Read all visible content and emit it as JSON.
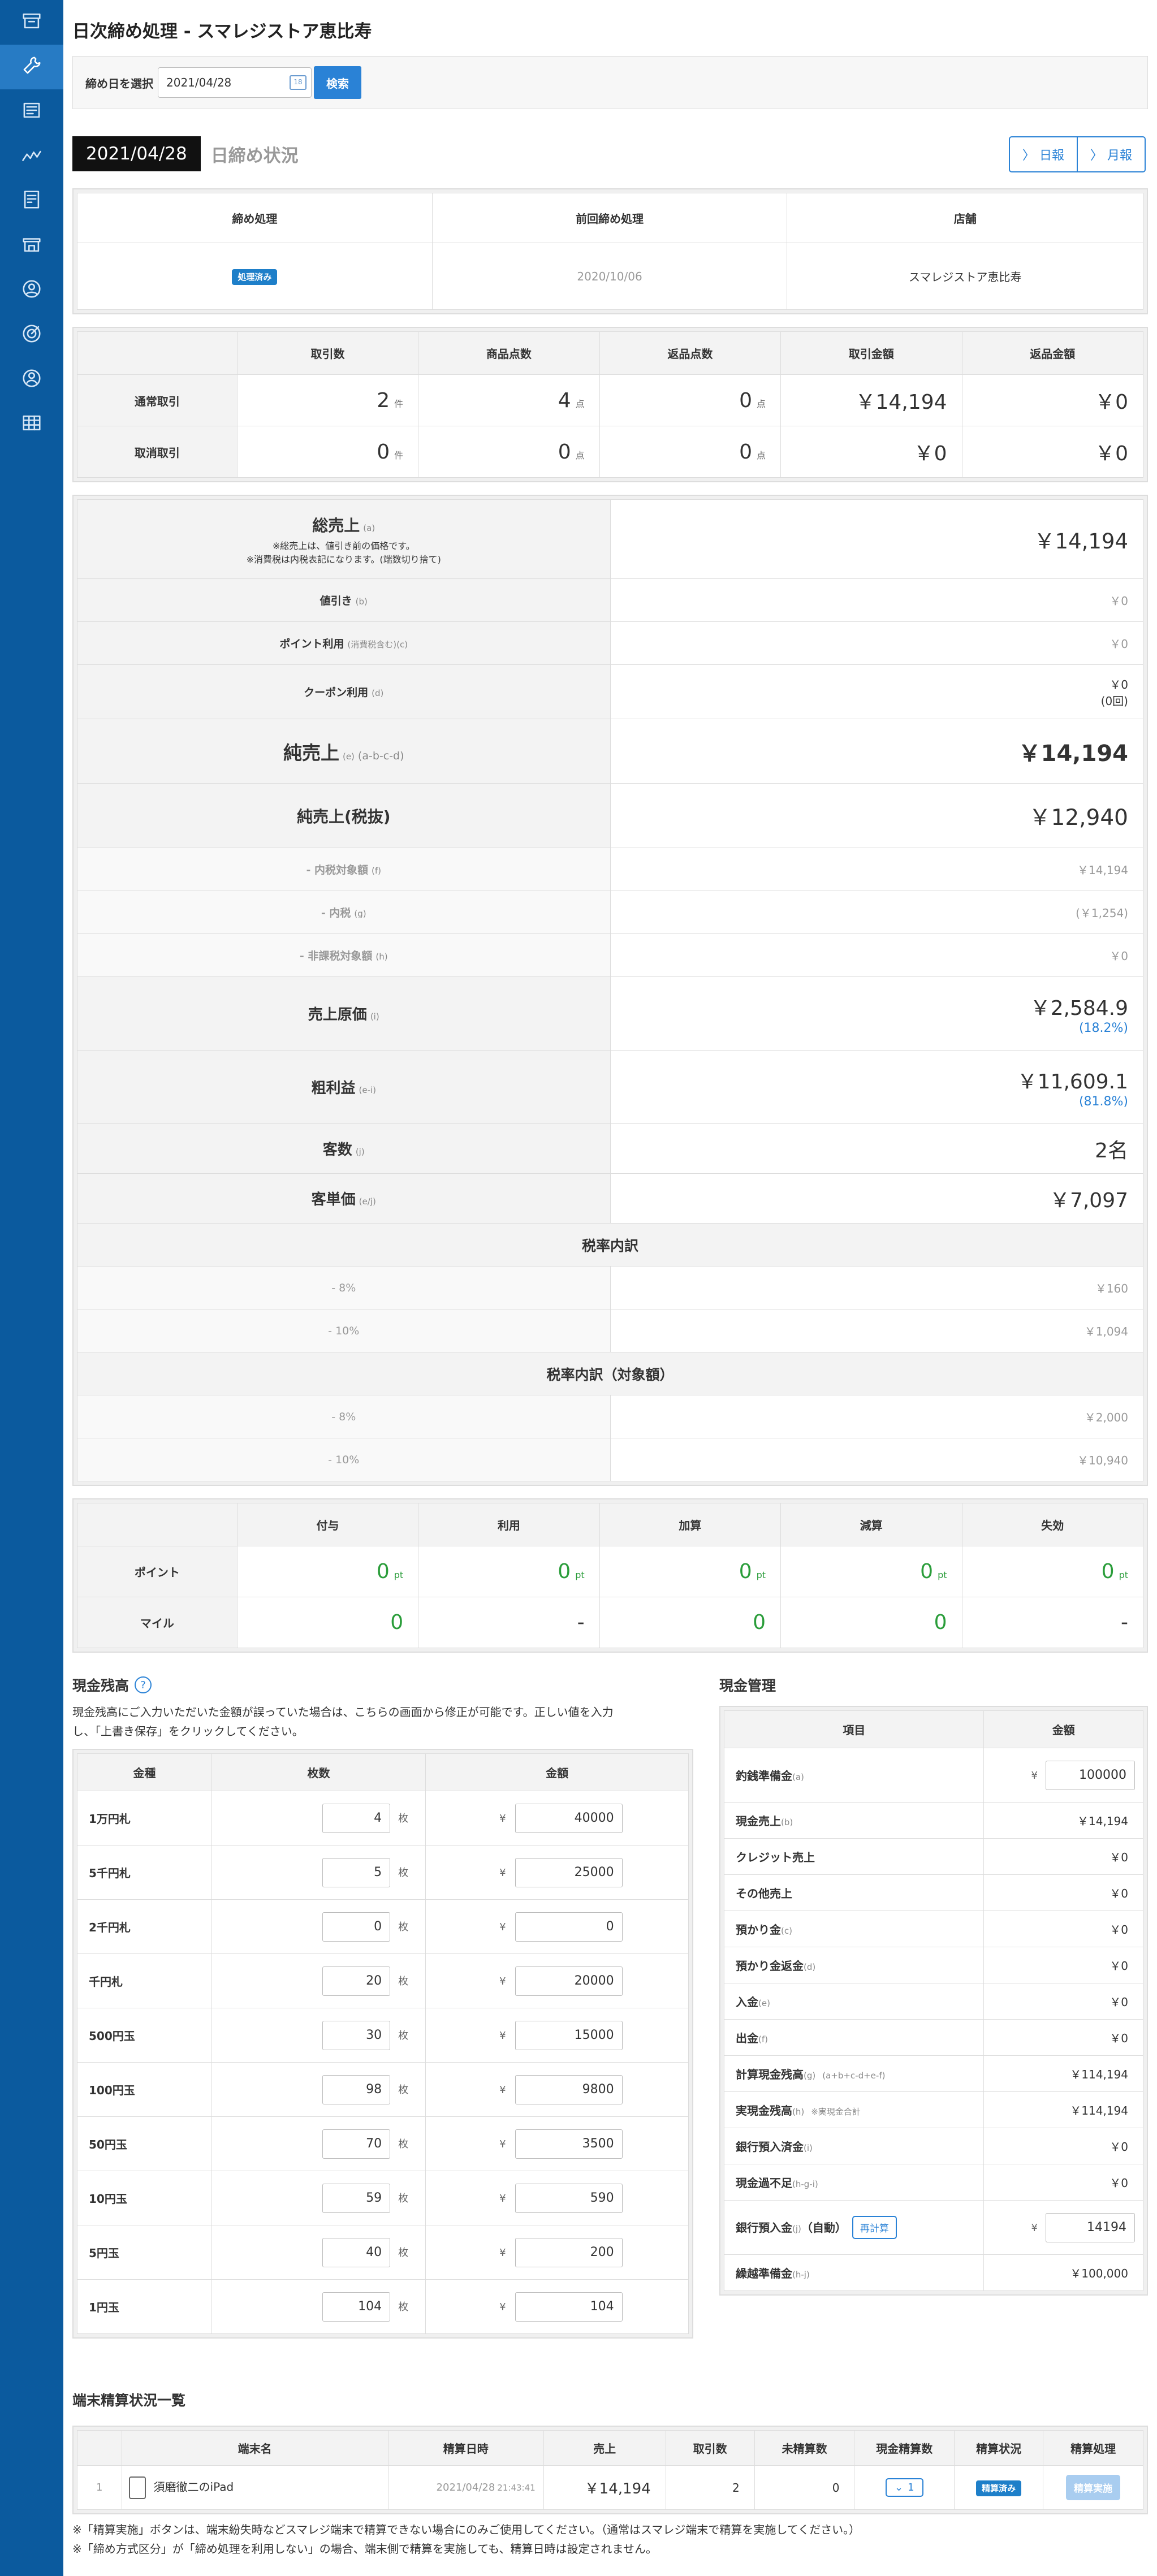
{
  "page": {
    "title": "日次締め処理 - スマレジストア恵比寿"
  },
  "sidebar": {
    "icons": [
      "archive-icon",
      "wrench-icon",
      "document-icon",
      "chart-line-icon",
      "report-icon",
      "store-icon",
      "user-circle-icon",
      "target-icon",
      "person-icon",
      "grid-table-icon"
    ],
    "active": 1
  },
  "search": {
    "label": "締め日を選択",
    "date": "2021/04/28",
    "button": "検索"
  },
  "status": {
    "date": "2021/04/28",
    "label": "日締め状況",
    "daily": "日報",
    "monthly": "月報"
  },
  "summary": {
    "headers": [
      "締め処理",
      "前回締め処理",
      "店舗"
    ],
    "badge": "処理済み",
    "prev_date": "2020/10/06",
    "store": "スマレジストア恵比寿"
  },
  "transactions": {
    "headers": [
      "取引数",
      "商品点数",
      "返品点数",
      "取引金額",
      "返品金額"
    ],
    "rows": [
      {
        "label": "通常取引",
        "count": "2",
        "count_unit": "件",
        "items": "4",
        "items_unit": "点",
        "returns": "0",
        "returns_unit": "点",
        "amount": "￥14,194",
        "return_amount": "￥0"
      },
      {
        "label": "取消取引",
        "count": "0",
        "count_unit": "件",
        "items": "0",
        "items_unit": "点",
        "returns": "0",
        "returns_unit": "点",
        "amount": "￥0",
        "return_amount": "￥0"
      }
    ]
  },
  "sales": {
    "gross": {
      "label": "総売上",
      "code": "(a)",
      "note1": "※総売上は、値引き前の価格です。",
      "note2": "※消費税は内税表記になります。(端数切り捨て)",
      "value": "￥14,194"
    },
    "discount": {
      "label": "値引き",
      "code": "(b)",
      "value": "￥0"
    },
    "points": {
      "label": "ポイント利用",
      "code": "(消費税含む)(c)",
      "value": "￥0"
    },
    "coupon": {
      "label": "クーポン利用",
      "code": "(d)",
      "value": "￥0",
      "count": "(0回)"
    },
    "net": {
      "label": "純売上",
      "code": "(e)",
      "formula": "(a-b-c-d)",
      "value": "￥14,194"
    },
    "net_ex": {
      "label": "純売上(税抜)",
      "value": "￥12,940"
    },
    "incl_target": {
      "label": "- 内税対象額",
      "code": "(f)",
      "value": "￥14,194"
    },
    "incl_tax": {
      "label": "- 内税",
      "code": "(g)",
      "value": "(￥1,254)"
    },
    "nontax": {
      "label": "- 非課税対象額",
      "code": "(h)",
      "value": "￥0"
    },
    "cost": {
      "label": "売上原価",
      "code": "(i)",
      "value": "￥2,584.9",
      "pct": "(18.2%)"
    },
    "profit": {
      "label": "粗利益",
      "code": "(e-i)",
      "value": "￥11,609.1",
      "pct": "(81.8%)"
    },
    "customers": {
      "label": "客数",
      "code": "(j)",
      "value": "2名"
    },
    "per_customer": {
      "label": "客単価",
      "code": "(e/j)",
      "value": "￥7,097"
    },
    "tax_breakdown": {
      "title": "税率内訳",
      "rows": [
        {
          "label": "- 8%",
          "value": "￥160"
        },
        {
          "label": "- 10%",
          "value": "￥1,094"
        }
      ]
    },
    "tax_target": {
      "title": "税率内訳（対象額）",
      "rows": [
        {
          "label": "- 8%",
          "value": "￥2,000"
        },
        {
          "label": "- 10%",
          "value": "￥10,940"
        }
      ]
    }
  },
  "points_table": {
    "headers": [
      "付与",
      "利用",
      "加算",
      "減算",
      "失効"
    ],
    "rows": [
      {
        "label": "ポイント",
        "unit": "pt",
        "values": [
          "0",
          "0",
          "0",
          "0",
          "0"
        ]
      },
      {
        "label": "マイル",
        "values": [
          "0",
          "-",
          "0",
          "0",
          "-"
        ]
      }
    ]
  },
  "cash_balance": {
    "title": "現金残高",
    "help": "?",
    "desc1": "現金残高にご入力いただいた金額が誤っていた場合は、こちらの画面から修正が可能です。正しい値を入力",
    "desc2": "し、「上書き保存」をクリックしてください。",
    "headers": [
      "金種",
      "枚数",
      "金額"
    ],
    "unit": "枚",
    "yen": "¥",
    "rows": [
      {
        "name": "1万円札",
        "qty": "4",
        "amount": "40000"
      },
      {
        "name": "5千円札",
        "qty": "5",
        "amount": "25000"
      },
      {
        "name": "2千円札",
        "qty": "0",
        "amount": "0"
      },
      {
        "name": "千円札",
        "qty": "20",
        "amount": "20000"
      },
      {
        "name": "500円玉",
        "qty": "30",
        "amount": "15000"
      },
      {
        "name": "100円玉",
        "qty": "98",
        "amount": "9800"
      },
      {
        "name": "50円玉",
        "qty": "70",
        "amount": "3500"
      },
      {
        "name": "10円玉",
        "qty": "59",
        "amount": "590"
      },
      {
        "name": "5円玉",
        "qty": "40",
        "amount": "200"
      },
      {
        "name": "1円玉",
        "qty": "104",
        "amount": "104"
      }
    ]
  },
  "cash_mgmt": {
    "title": "現金管理",
    "headers": [
      "項目",
      "金額"
    ],
    "yen": "¥",
    "change_fund": {
      "label": "釣銭準備金",
      "code": "(a)",
      "value": "100000"
    },
    "rows": [
      {
        "label": "現金売上",
        "code": "(b)",
        "value": "￥14,194"
      },
      {
        "label": "クレジット売上",
        "code": "",
        "value": "￥0"
      },
      {
        "label": "その他売上",
        "code": "",
        "value": "￥0"
      },
      {
        "label": "預かり金",
        "code": "(c)",
        "value": "￥0"
      },
      {
        "label": "預かり金返金",
        "code": "(d)",
        "value": "￥0"
      },
      {
        "label": "入金",
        "code": "(e)",
        "value": "￥0"
      },
      {
        "label": "出金",
        "code": "(f)",
        "value": "￥0"
      },
      {
        "label": "計算現金残高",
        "code": "(g)",
        "note": "(a+b+c-d+e-f)",
        "value": "￥114,194"
      },
      {
        "label": "実現金残高",
        "code": "(h)",
        "note": "※実現金合計",
        "value": "￥114,194"
      },
      {
        "label": "銀行預入済金",
        "code": "(i)",
        "value": "￥0"
      },
      {
        "label": "現金過不足",
        "code": "(h-g-i)",
        "value": "￥0"
      }
    ],
    "deposit": {
      "label": "銀行預入金",
      "code": "(j)",
      "auto": "（自動）",
      "recalc": "再計算",
      "value": "14194"
    },
    "carry": {
      "label": "繰越準備金",
      "code": "(h-j)",
      "value": "￥100,000"
    }
  },
  "terminals": {
    "title": "端末精算状況一覧",
    "headers": [
      "端末名",
      "精算日時",
      "売上",
      "取引数",
      "未精算数",
      "現金精算数",
      "精算状況",
      "精算処理"
    ],
    "rows": [
      {
        "no": "1",
        "name": "須磨徹二のiPad",
        "date": "2021/04/28",
        "time": "21:43:41",
        "sales": "￥14,194",
        "count": "2",
        "unsettled": "0",
        "cash_count": "1",
        "status": "精算済み",
        "action": "精算実施"
      }
    ],
    "note1": "※「精算実施」ボタンは、端末紛失時などスマレジ端末で精算できない場合にのみご使用してください。（通常はスマレジ端末で精算を実施してください。）",
    "note2": "※「締め方式区分」が「締め処理を利用しない」の場合、端末側で精算を実施しても、精算日時は設定されません。"
  }
}
